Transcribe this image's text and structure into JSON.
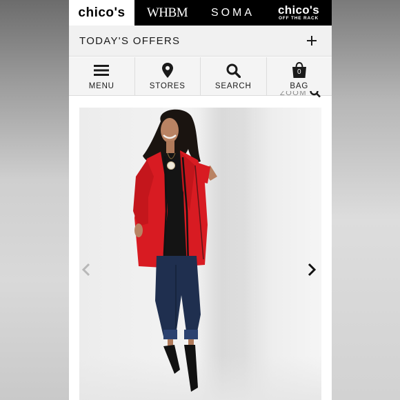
{
  "brands": {
    "chicos": "chico's",
    "whbm": "WHBM",
    "soma": "SOMA",
    "otr_name": "chico's",
    "otr_sub": "OFF THE RACK"
  },
  "offers": {
    "label": "TODAY'S OFFERS"
  },
  "nav": [
    {
      "label": "MENU",
      "icon": "hamburger-icon"
    },
    {
      "label": "STORES",
      "icon": "map-pin-icon"
    },
    {
      "label": "SEARCH",
      "icon": "search-icon"
    },
    {
      "label": "BAG",
      "icon": "shopping-bag-icon",
      "count": "0"
    }
  ],
  "zoom": {
    "label": "ZOOM"
  },
  "colors": {
    "brand_bar": "#000000",
    "jacket": "#d81b22",
    "jeans": "#1f2f4f",
    "nav_bg": "#f4f4f4"
  }
}
